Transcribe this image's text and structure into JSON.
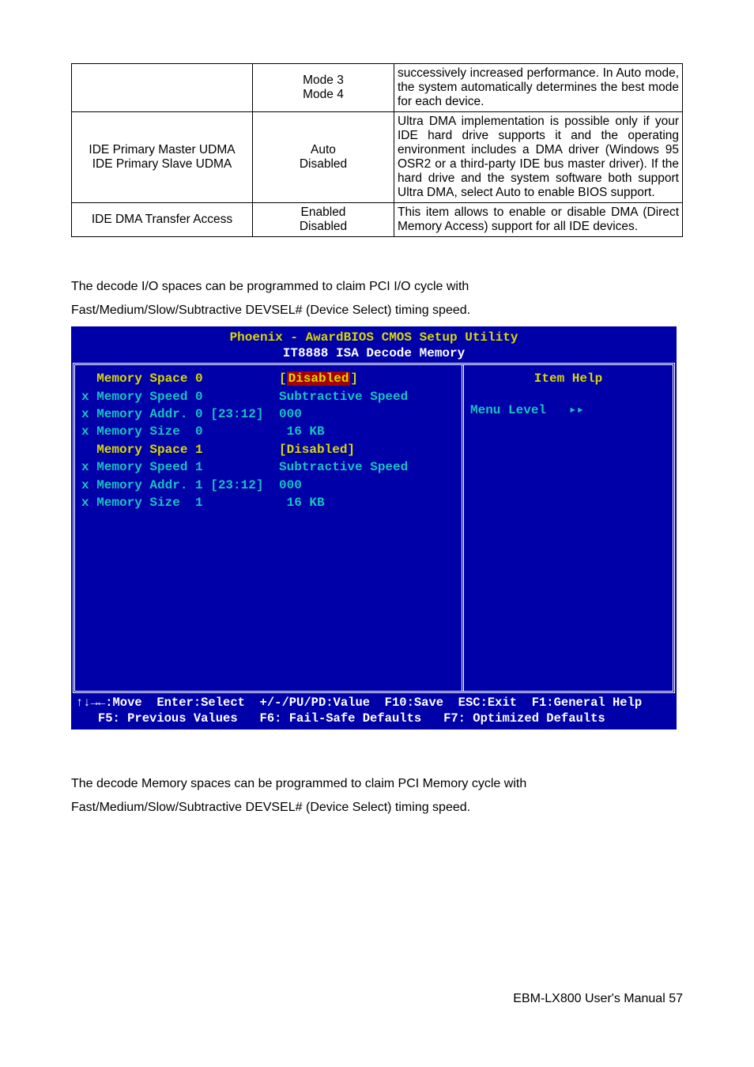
{
  "table": {
    "r0": {
      "c2a": "Mode 3",
      "c2b": "Mode 4",
      "c3": "successively increased performance. In Auto mode, the system automatically determines the best mode for each device."
    },
    "r1": {
      "c1a": "IDE Primary Master UDMA",
      "c1b": "IDE Primary Slave UDMA",
      "c2a": "Auto",
      "c2b": "Disabled",
      "c3": "Ultra DMA implementation is possible only if your IDE hard drive supports it and the operating environment includes a DMA driver (Windows 95 OSR2 or a third-party IDE bus master driver). If the hard drive and the system software both support Ultra DMA, select Auto to enable BIOS support."
    },
    "r2": {
      "c1": "IDE DMA Transfer Access",
      "c2a": "Enabled",
      "c2b": "Disabled",
      "c3": "This item allows to enable or disable DMA (Direct Memory Access) support for all IDE devices."
    }
  },
  "para1a": "The decode I/O spaces can be programmed to claim PCI I/O cycle with",
  "para1b": "Fast/Medium/Slow/Subtractive DEVSEL# (Device Select) timing speed.",
  "bios": {
    "title1": "Phoenix - AwardBIOS CMOS Setup Utility",
    "title2": "IT8888 ISA Decode Memory",
    "rows": {
      "l0": "  Memory Space 0",
      "v0_open": "[",
      "v0_mid": "Disabled",
      "v0_close": "]",
      "l1": "x Memory Speed 0",
      "v1": "Subtractive Speed",
      "l2": "x Memory Addr. 0 [23:12]",
      "v2": "000",
      "l3": "x Memory Size  0",
      "v3": " 16 KB",
      "l4": "  Memory Space 1",
      "v4": "[Disabled]",
      "l5": "x Memory Speed 1",
      "v5": "Subtractive Speed",
      "l6": "x Memory Addr. 1 [23:12]",
      "v6": "000",
      "l7": "x Memory Size  1",
      "v7": " 16 KB"
    },
    "help": "Item Help",
    "menulevel": "Menu Level   ▸▸",
    "foot1": "↑↓→←:Move  Enter:Select  +/-/PU/PD:Value  F10:Save  ESC:Exit  F1:General Help",
    "foot2": "   F5: Previous Values   F6: Fail-Safe Defaults   F7: Optimized Defaults"
  },
  "para2a": "The decode Memory spaces can be programmed to claim PCI Memory cycle with",
  "para2b": "Fast/Medium/Slow/Subtractive DEVSEL# (Device Select) timing speed.",
  "footer": "EBM-LX800  User's  Manual 57"
}
